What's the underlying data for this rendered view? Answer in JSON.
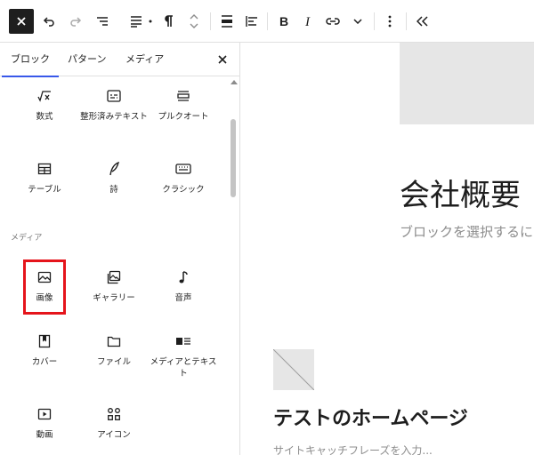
{
  "toolbar": {
    "items": [
      "close-icon",
      "undo-icon",
      "redo-icon",
      "list-view-icon",
      "align-icon",
      "dot-icon",
      "pilcrow-icon",
      "move-updown-icon",
      "block-align-icon",
      "justify-icon",
      "bold-icon",
      "italic-icon",
      "link-icon",
      "chevron-down-icon",
      "more-options-icon",
      "collapse-icon"
    ]
  },
  "inserter": {
    "tabs": [
      "ブロック",
      "パターン",
      "メディア"
    ],
    "active_tab": "ブロック",
    "section_media": "メディア",
    "blocks_text": [
      {
        "label": "数式",
        "icon": "math-icon"
      },
      {
        "label": "整形済みテキスト",
        "icon": "preformatted-icon"
      },
      {
        "label": "プルクオート",
        "icon": "pullquote-icon"
      },
      {
        "label": "テーブル",
        "icon": "table-icon"
      },
      {
        "label": "詩",
        "icon": "verse-icon"
      },
      {
        "label": "クラシック",
        "icon": "classic-icon"
      }
    ],
    "blocks_media": [
      {
        "label": "画像",
        "icon": "image-icon"
      },
      {
        "label": "ギャラリー",
        "icon": "gallery-icon"
      },
      {
        "label": "音声",
        "icon": "audio-icon"
      },
      {
        "label": "カバー",
        "icon": "cover-icon"
      },
      {
        "label": "ファイル",
        "icon": "file-icon"
      },
      {
        "label": "メディアとテキスト",
        "icon": "media-text-icon"
      },
      {
        "label": "動画",
        "icon": "video-icon"
      },
      {
        "label": "アイコン",
        "icon": "icons-icon"
      }
    ],
    "highlight_color": "#e5141b"
  },
  "canvas": {
    "heading": "会社概要",
    "placeholder": "ブロックを選択するに",
    "site_title": "テストのホームページ",
    "tagline": "サイトキャッチフレーズを入力..."
  },
  "colors": {
    "accent": "#3858e9",
    "dark": "#1e1e1e"
  }
}
